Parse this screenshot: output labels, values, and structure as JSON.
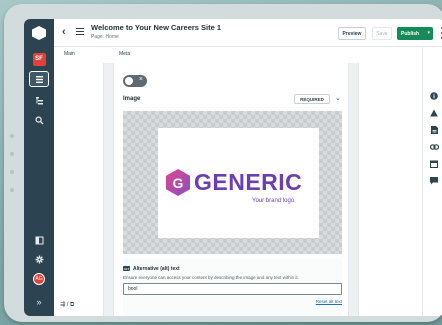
{
  "header": {
    "title": "Welcome to Your New Careers Site 1",
    "subtitle": "Page: Home",
    "preview_label": "Preview",
    "save_label": "Save",
    "publish_label": "Publish"
  },
  "tabs": [
    {
      "label": "Main"
    },
    {
      "label": "Meta"
    }
  ],
  "sidebar": {
    "badge": "SF",
    "avatar": "AG"
  },
  "image_field": {
    "label": "Image",
    "required_label": "REQUIRED"
  },
  "brand": {
    "logo_letter": "G",
    "word": "GENERIC",
    "tagline": "Your brand logo"
  },
  "alt_text": {
    "tag": "ALT",
    "title": "Alternative (alt) text",
    "description": "Ensure everyone can access your content by describing the image and any text within it.",
    "value": "bool",
    "reset_label": "Reset alt text"
  },
  "icons": [
    "back-arrow-icon",
    "menu-icon",
    "chevron-down-icon",
    "more-vertical-icon",
    "info-icon",
    "warning-icon",
    "document-icon",
    "link-icon",
    "calendar-icon",
    "comment-icon",
    "pages-icon",
    "tree-icon",
    "search-icon",
    "layout-icon",
    "gear-icon",
    "expand-icon",
    "close-icon"
  ],
  "colors": {
    "sidebar": "#2c4452",
    "publish": "#178a5a",
    "brand_purple": "#6a3fb4",
    "brand_pink": "#e0468f",
    "badge_red": "#e0413a"
  }
}
